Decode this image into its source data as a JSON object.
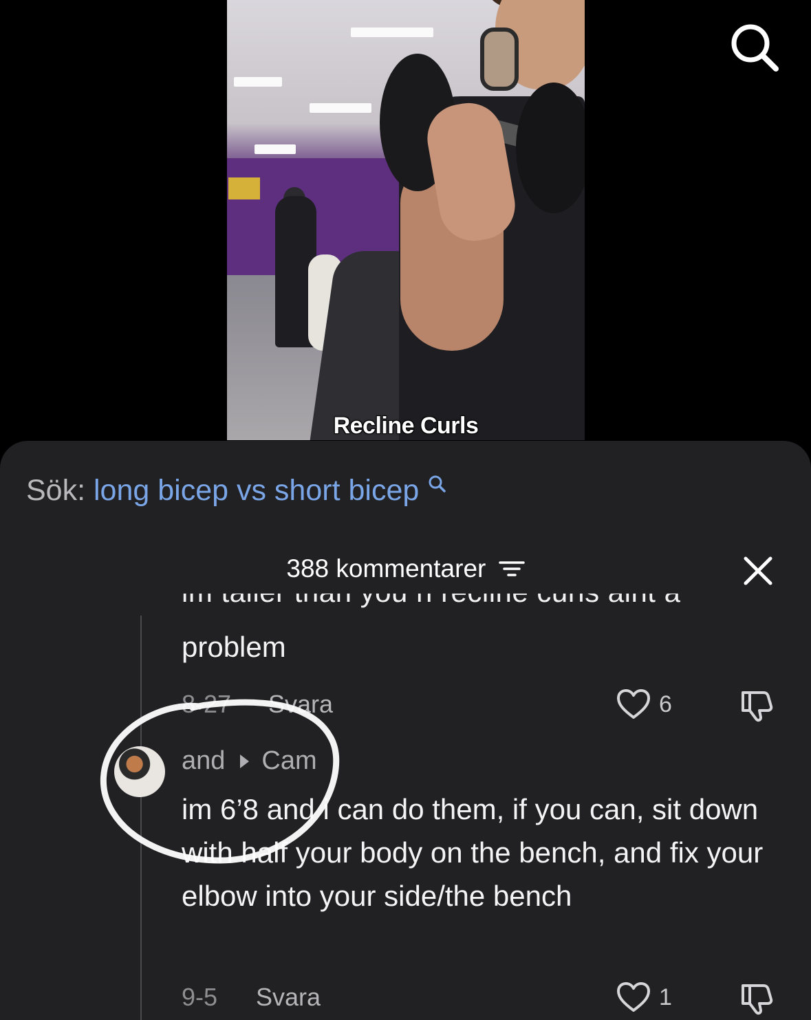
{
  "video": {
    "caption": "Recline Curls",
    "search_icon": "search-icon"
  },
  "comments_sheet": {
    "search_prefix": "Sök:",
    "search_query": "long bicep vs short bicep",
    "search_suggest_icon": "search-icon",
    "header_title": "388 kommentarer",
    "filter_icon": "filter-icon",
    "close_icon": "close-icon",
    "partial_comment": {
      "text_cut_top": "im taller than you n recline curls aint a",
      "text_last_line": "problem",
      "date": "8-27",
      "reply_label": "Svara",
      "like_count": "6"
    },
    "reply_comment": {
      "author": "and",
      "reply_to": "Cam",
      "text": "im 6’8 and i can do them, if you can, sit down with half your body on the bench, and fix your elbow into your side/the bench",
      "date": "9-5",
      "reply_label": "Svara",
      "like_count": "1"
    }
  },
  "colors": {
    "sheet_background": "#212123",
    "link_blue": "#7aa6e8",
    "muted_text": "#8e8e93",
    "annotation": "#ffffff"
  }
}
